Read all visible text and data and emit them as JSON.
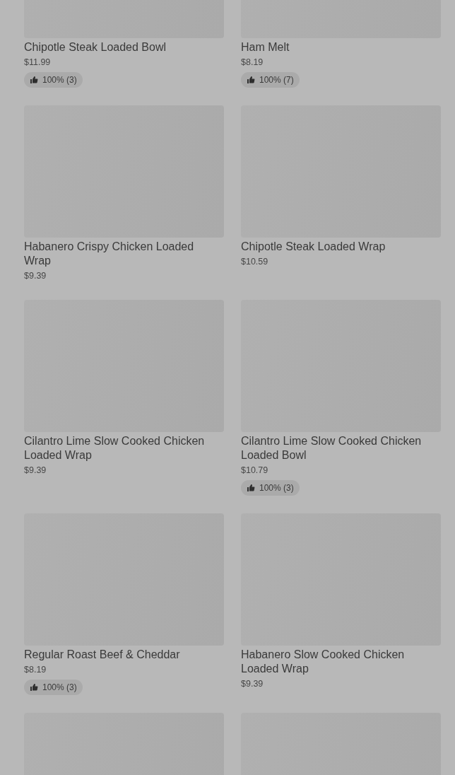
{
  "items": [
    {
      "name": "Chipotle Steak Loaded Bowl",
      "price": "$11.99",
      "rating": "100% (3)"
    },
    {
      "name": "Ham Melt",
      "price": "$8.19",
      "rating": "100% (7)"
    },
    {
      "name": "Habanero Crispy Chicken Loaded Wrap",
      "price": "$9.39"
    },
    {
      "name": "Chipotle Steak Loaded Wrap",
      "price": "$10.59"
    },
    {
      "name": "Cilantro Lime Slow Cooked Chicken Loaded Wrap",
      "price": "$9.39"
    },
    {
      "name": "Cilantro Lime Slow Cooked Chicken Loaded Bowl",
      "price": "$10.79",
      "rating": "100% (3)"
    },
    {
      "name": "Regular Roast Beef & Cheddar",
      "price": "$8.19",
      "rating": "100% (3)"
    },
    {
      "name": "Habanero Slow Cooked Chicken Loaded Wrap",
      "price": "$9.39"
    },
    {
      "kind": "image_only"
    },
    {
      "kind": "image_only"
    }
  ]
}
